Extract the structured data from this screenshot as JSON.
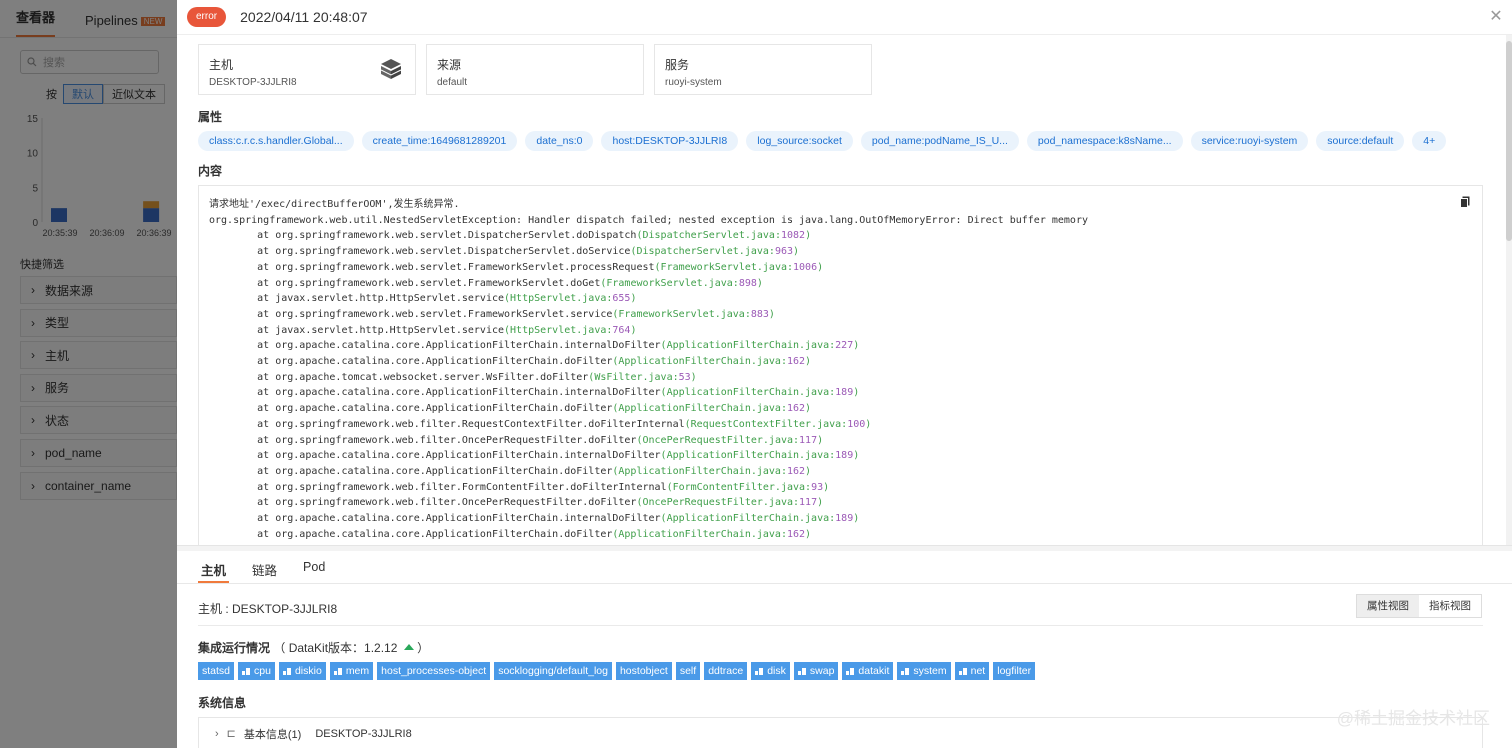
{
  "left_panel": {
    "tabs": [
      {
        "label": "查看器",
        "active": true
      },
      {
        "label": "Pipelines",
        "badge": "NEW",
        "active": false
      }
    ],
    "search_placeholder": "搜索",
    "mode_label": "按",
    "mode_options": [
      {
        "label": "默认",
        "active": true
      },
      {
        "label": "近似文本",
        "active": false
      }
    ],
    "mini_chart": {
      "y_ticks": [
        "15",
        "10",
        "5",
        "0"
      ],
      "x_ticks": [
        "20:35:39",
        "20:36:09",
        "20:36:39"
      ],
      "bars": [
        {
          "x_index": 0,
          "segments": [
            {
              "value": 2,
              "color": "#3b6dc6"
            }
          ]
        },
        {
          "x_index": 2,
          "segments": [
            {
              "value": 2,
              "color": "#3b6dc6"
            },
            {
              "value": 1,
              "color": "#e9a03b"
            }
          ]
        }
      ],
      "y_max": 15
    },
    "quick_filter_title": "快捷筛选",
    "filters": [
      "数据来源",
      "类型",
      "主机",
      "服务",
      "状态",
      "pod_name",
      "container_name"
    ]
  },
  "drawer": {
    "status": "error",
    "status_color": "#e8563a",
    "time": "2022/04/11 20:48:07",
    "cards": [
      {
        "title": "主机",
        "value": "DESKTOP-3JJLRI8",
        "icon": "cube-icon"
      },
      {
        "title": "来源",
        "value": "default"
      },
      {
        "title": "服务",
        "value": "ruoyi-system"
      }
    ],
    "attributes_title": "属性",
    "attributes": [
      "class:c.r.c.s.handler.Global...",
      "create_time:1649681289201",
      "date_ns:0",
      "host:DESKTOP-3JJLRI8",
      "log_source:socket",
      "pod_name:podName_IS_U...",
      "pod_namespace:k8sName...",
      "service:ruoyi-system",
      "source:default",
      "4+"
    ],
    "content_title": "内容",
    "log_lines": [
      {
        "text": "请求地址'/exec/directBufferOOM',发生系统异常."
      },
      {
        "text": "org.springframework.web.util.NestedServletException: Handler dispatch failed; nested exception is java.lang.OutOfMemoryError: Direct buffer memory"
      },
      {
        "prefix": "        at org.springframework.web.servlet.DispatcherServlet.doDispatch",
        "file": "DispatcherServlet.java",
        "line": "1082"
      },
      {
        "prefix": "        at org.springframework.web.servlet.DispatcherServlet.doService",
        "file": "DispatcherServlet.java",
        "line": "963"
      },
      {
        "prefix": "        at org.springframework.web.servlet.FrameworkServlet.processRequest",
        "file": "FrameworkServlet.java",
        "line": "1006"
      },
      {
        "prefix": "        at org.springframework.web.servlet.FrameworkServlet.doGet",
        "file": "FrameworkServlet.java",
        "line": "898"
      },
      {
        "prefix": "        at javax.servlet.http.HttpServlet.service",
        "file": "HttpServlet.java",
        "line": "655"
      },
      {
        "prefix": "        at org.springframework.web.servlet.FrameworkServlet.service",
        "file": "FrameworkServlet.java",
        "line": "883"
      },
      {
        "prefix": "        at javax.servlet.http.HttpServlet.service",
        "file": "HttpServlet.java",
        "line": "764"
      },
      {
        "prefix": "        at org.apache.catalina.core.ApplicationFilterChain.internalDoFilter",
        "file": "ApplicationFilterChain.java",
        "line": "227"
      },
      {
        "prefix": "        at org.apache.catalina.core.ApplicationFilterChain.doFilter",
        "file": "ApplicationFilterChain.java",
        "line": "162"
      },
      {
        "prefix": "        at org.apache.tomcat.websocket.server.WsFilter.doFilter",
        "file": "WsFilter.java",
        "line": "53"
      },
      {
        "prefix": "        at org.apache.catalina.core.ApplicationFilterChain.internalDoFilter",
        "file": "ApplicationFilterChain.java",
        "line": "189"
      },
      {
        "prefix": "        at org.apache.catalina.core.ApplicationFilterChain.doFilter",
        "file": "ApplicationFilterChain.java",
        "line": "162"
      },
      {
        "prefix": "        at org.springframework.web.filter.RequestContextFilter.doFilterInternal",
        "file": "RequestContextFilter.java",
        "line": "100"
      },
      {
        "prefix": "        at org.springframework.web.filter.OncePerRequestFilter.doFilter",
        "file": "OncePerRequestFilter.java",
        "line": "117"
      },
      {
        "prefix": "        at org.apache.catalina.core.ApplicationFilterChain.internalDoFilter",
        "file": "ApplicationFilterChain.java",
        "line": "189"
      },
      {
        "prefix": "        at org.apache.catalina.core.ApplicationFilterChain.doFilter",
        "file": "ApplicationFilterChain.java",
        "line": "162"
      },
      {
        "prefix": "        at org.springframework.web.filter.FormContentFilter.doFilterInternal",
        "file": "FormContentFilter.java",
        "line": "93"
      },
      {
        "prefix": "        at org.springframework.web.filter.OncePerRequestFilter.doFilter",
        "file": "OncePerRequestFilter.java",
        "line": "117"
      },
      {
        "prefix": "        at org.apache.catalina.core.ApplicationFilterChain.internalDoFilter",
        "file": "ApplicationFilterChain.java",
        "line": "189"
      },
      {
        "prefix": "        at org.apache.catalina.core.ApplicationFilterChain.doFilter",
        "file": "ApplicationFilterChain.java",
        "line": "162"
      }
    ],
    "bottom_tabs": [
      {
        "label": "主机",
        "active": true
      },
      {
        "label": "链路",
        "active": false
      },
      {
        "label": "Pod",
        "active": false
      }
    ],
    "host_label": "主机 : DESKTOP-3JJLRI8",
    "view_toggle": [
      {
        "label": "属性视图",
        "active": true
      },
      {
        "label": "指标视图",
        "active": false
      }
    ],
    "integration_title": "集成运行情况",
    "datakit_version_label": "（ DataKit版本：1.2.12",
    "datakit_version_close": "）",
    "integration_tags": [
      {
        "label": "statsd",
        "icon": false
      },
      {
        "label": "cpu",
        "icon": true
      },
      {
        "label": "diskio",
        "icon": true
      },
      {
        "label": "mem",
        "icon": true
      },
      {
        "label": "host_processes-object",
        "icon": false
      },
      {
        "label": "socklogging/default_log",
        "icon": false
      },
      {
        "label": "hostobject",
        "icon": false
      },
      {
        "label": "self",
        "icon": false
      },
      {
        "label": "ddtrace",
        "icon": false
      },
      {
        "label": "disk",
        "icon": true
      },
      {
        "label": "swap",
        "icon": true
      },
      {
        "label": "datakit",
        "icon": true
      },
      {
        "label": "system",
        "icon": true
      },
      {
        "label": "net",
        "icon": true
      },
      {
        "label": "logfilter",
        "icon": false
      }
    ],
    "sysinfo_title": "系统信息",
    "sysinfo_row": {
      "label": "基本信息(1)",
      "value": "DESKTOP-3JJLRI8"
    },
    "watermark": "@稀土掘金技术社区"
  }
}
